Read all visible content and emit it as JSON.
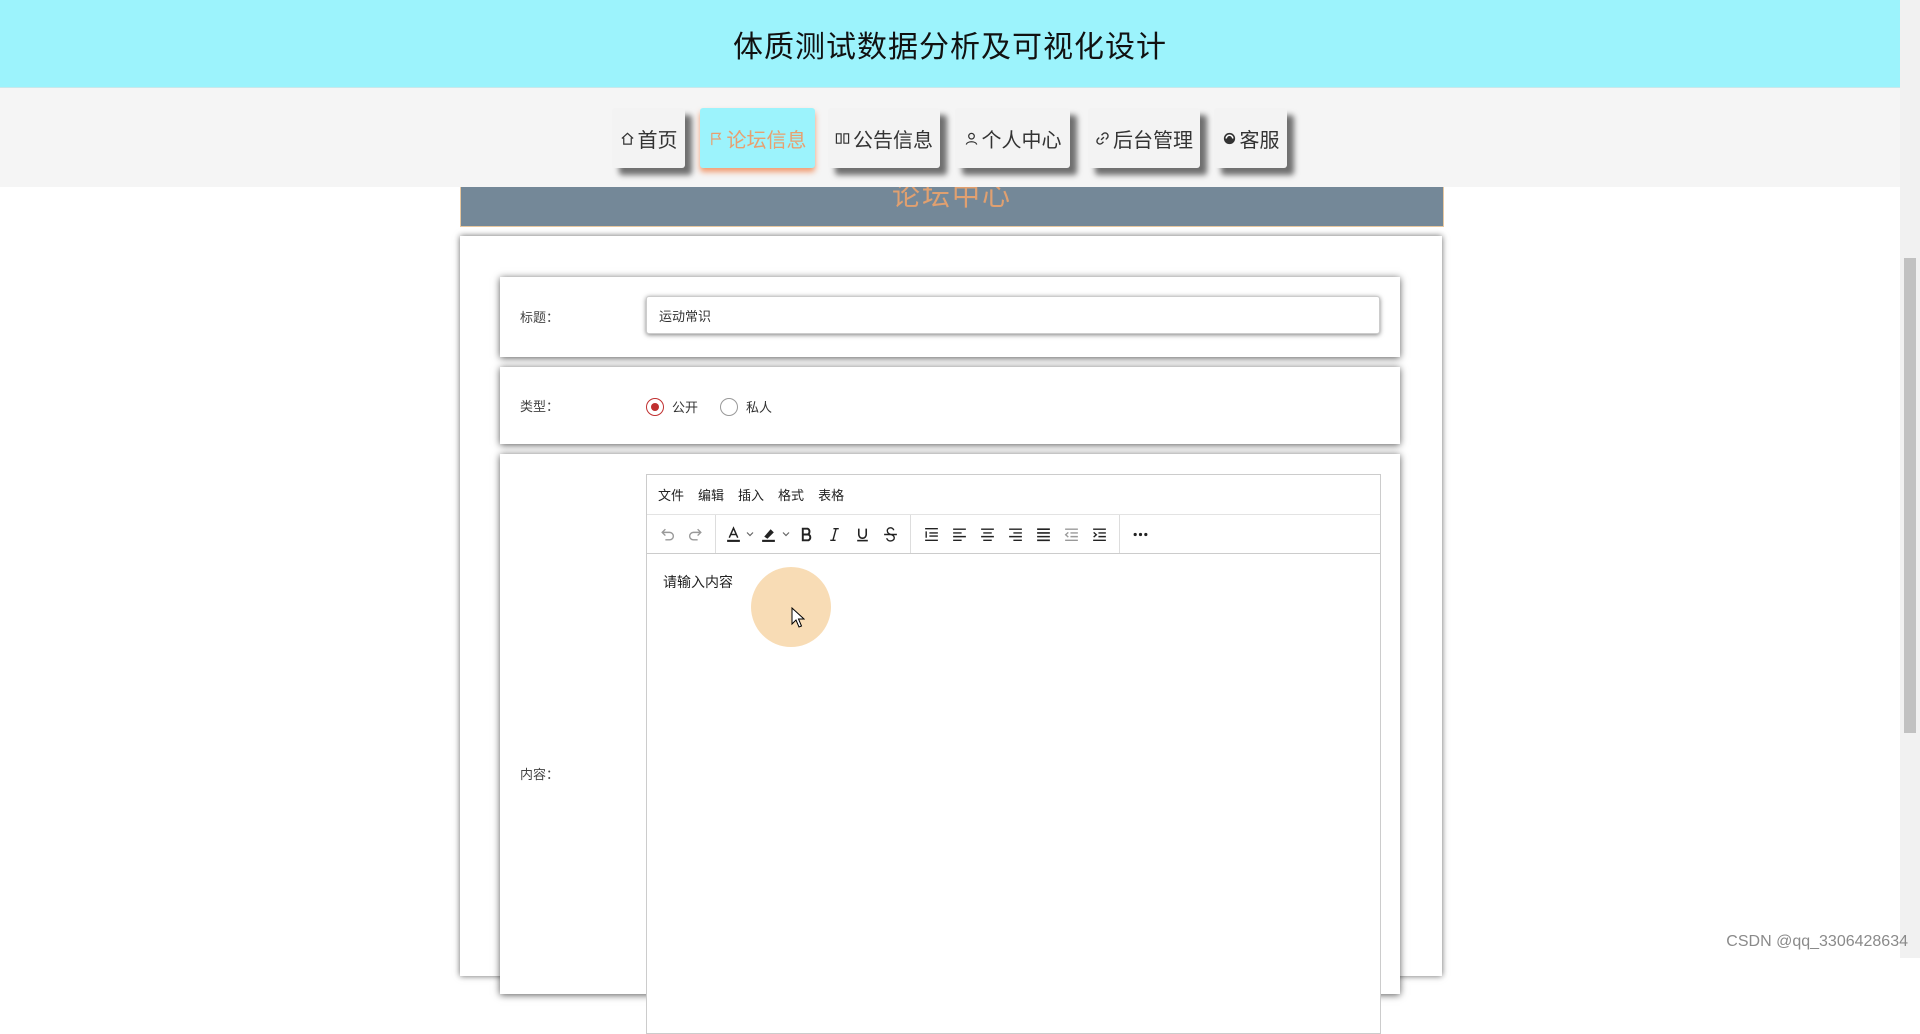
{
  "header": {
    "title": "体质测试数据分析及可视化设计"
  },
  "nav": {
    "items": [
      {
        "label": "首页",
        "icon": "home-icon",
        "active": false
      },
      {
        "label": "论坛信息",
        "icon": "flag-icon",
        "active": true
      },
      {
        "label": "公告信息",
        "icon": "book-icon",
        "active": false
      },
      {
        "label": "个人中心",
        "icon": "user-icon",
        "active": false
      },
      {
        "label": "后台管理",
        "icon": "link-icon",
        "active": false
      },
      {
        "label": "客服",
        "icon": "chat-icon",
        "active": false
      }
    ]
  },
  "banner": {
    "title": "论坛中心"
  },
  "form": {
    "title_label": "标题：",
    "title_value": "运动常识",
    "type_label": "类型：",
    "type_options": [
      {
        "label": "公开",
        "checked": true
      },
      {
        "label": "私人",
        "checked": false
      }
    ],
    "content_label": "内容："
  },
  "editor": {
    "menu": [
      "文件",
      "编辑",
      "插入",
      "格式",
      "表格"
    ],
    "toolbar_icons": [
      "undo-icon",
      "redo-icon",
      "font-color-icon",
      "highlight-icon",
      "bold-icon",
      "italic-icon",
      "underline-icon",
      "strikethrough-icon",
      "line-height-icon",
      "align-left-icon",
      "align-center-icon",
      "align-right-icon",
      "align-justify-icon",
      "outdent-icon",
      "indent-icon",
      "more-icon"
    ],
    "placeholder": "请输入内容"
  },
  "watermark": "CSDN @qq_3306428634",
  "colors": {
    "header_bg": "#9cf3fc",
    "active_text": "#e8a070",
    "banner_bg": "#748898",
    "radio_checked": "#c03030"
  }
}
